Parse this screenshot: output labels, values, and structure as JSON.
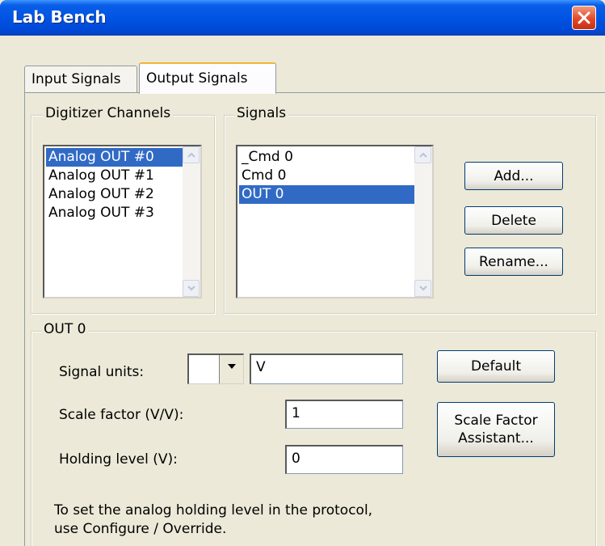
{
  "window": {
    "title": "Lab Bench"
  },
  "tabs": [
    {
      "label": "Input Signals",
      "active": false
    },
    {
      "label": "Output Signals",
      "active": true
    }
  ],
  "digitizer": {
    "label": "Digitizer Channels",
    "items": [
      "Analog OUT #0",
      "Analog OUT #1",
      "Analog OUT #2",
      "Analog OUT #3"
    ],
    "selected_index": 0
  },
  "signals": {
    "label": "Signals",
    "items": [
      "_Cmd 0",
      "Cmd 0",
      "OUT 0"
    ],
    "selected_index": 2,
    "buttons": {
      "add": "Add...",
      "delete": "Delete",
      "rename": "Rename..."
    }
  },
  "out": {
    "label": "OUT 0",
    "units_label": "Signal units:",
    "units_value": "V",
    "scale_label": "Scale factor (V/V):",
    "scale_value": "1",
    "holding_label": "Holding level (V):",
    "holding_value": "0",
    "default_button": "Default",
    "assistant_line1": "Scale Factor",
    "assistant_line2": "Assistant...",
    "note_line1": "To set the analog holding level in the protocol,",
    "note_line2": "use Configure / Override."
  },
  "colors": {
    "selection": "#316ac5",
    "titlebar": "#0054e3",
    "panel": "#ece9d8"
  },
  "icons": {
    "close": "close-icon",
    "scroll_up": "scroll-up-arrow-icon",
    "scroll_down": "scroll-down-arrow-icon",
    "dropdown": "dropdown-arrow-icon"
  }
}
